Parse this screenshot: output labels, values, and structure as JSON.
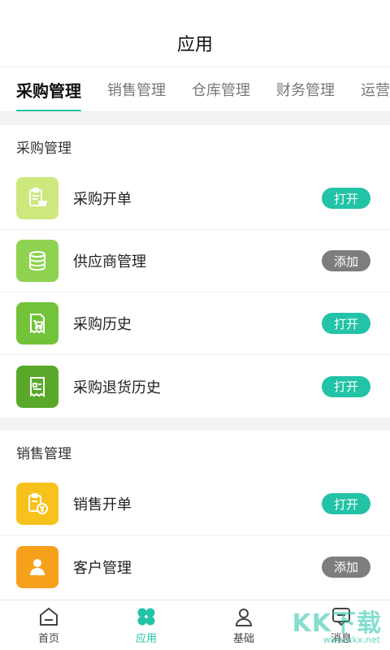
{
  "header": {
    "title": "应用"
  },
  "tabs": [
    {
      "label": "采购管理",
      "active": true
    },
    {
      "label": "销售管理",
      "active": false
    },
    {
      "label": "仓库管理",
      "active": false
    },
    {
      "label": "财务管理",
      "active": false
    },
    {
      "label": "运营",
      "active": false
    }
  ],
  "sections": [
    {
      "title": "采购管理",
      "items": [
        {
          "label": "采购开单",
          "action": "打开",
          "icon": "clipboard-cart-icon",
          "color": "#cde87d"
        },
        {
          "label": "供应商管理",
          "action": "添加",
          "icon": "database-stack-icon",
          "color": "#8ed24f"
        },
        {
          "label": "采购历史",
          "action": "打开",
          "icon": "receipt-cart-icon",
          "color": "#72c33a"
        },
        {
          "label": "采购退货历史",
          "action": "打开",
          "icon": "receipt-return-icon",
          "color": "#5aa82a"
        }
      ]
    },
    {
      "title": "销售管理",
      "items": [
        {
          "label": "销售开单",
          "action": "打开",
          "icon": "clipboard-yen-icon",
          "color": "#f7c21c"
        },
        {
          "label": "客户管理",
          "action": "添加",
          "icon": "person-icon",
          "color": "#f7a01c"
        }
      ]
    }
  ],
  "bottom_nav": [
    {
      "label": "首页",
      "icon": "home-icon",
      "active": false
    },
    {
      "label": "应用",
      "icon": "clover-icon",
      "active": true
    },
    {
      "label": "基础",
      "icon": "user-icon",
      "active": false
    },
    {
      "label": "消息",
      "icon": "message-icon",
      "active": false
    }
  ],
  "watermark": {
    "text": "KK下载",
    "url": "www.kkx.net"
  },
  "colors": {
    "accent": "#22c3a6",
    "add_pill": "#7d7d7d"
  }
}
